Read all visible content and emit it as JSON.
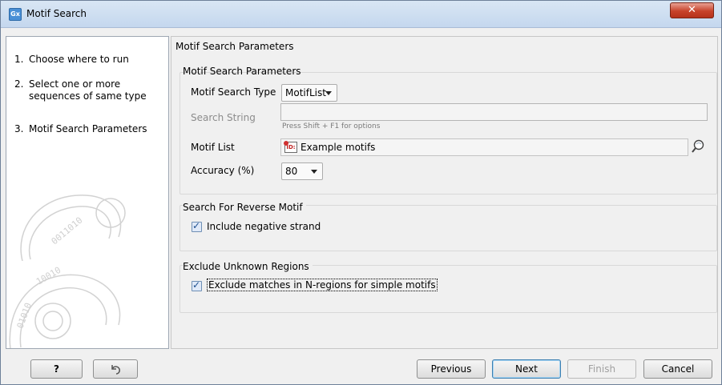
{
  "window": {
    "title": "Motif Search",
    "app_icon_text": "Gx",
    "close_glyph": "✕"
  },
  "steps": [
    {
      "num": "1.",
      "label": "Choose where to run"
    },
    {
      "num": "2.",
      "label": "Select one or more sequences of same type"
    },
    {
      "num": "3.",
      "label": "Motif Search Parameters"
    }
  ],
  "content": {
    "header": "Motif Search Parameters",
    "params_group": {
      "title": "Motif Search Parameters",
      "type_label": "Motif Search Type",
      "type_value": "MotifList",
      "search_string_label": "Search String",
      "search_string_value": "",
      "search_string_hint": "Press Shift + F1 for options",
      "motif_list_label": "Motif List",
      "motif_list_value": "Example motifs",
      "motif_list_icon_text": "ID:",
      "accuracy_label": "Accuracy (%)",
      "accuracy_value": "80"
    },
    "reverse_group": {
      "title": "Search For Reverse Motif",
      "checkbox_label": "Include negative strand",
      "checked": true
    },
    "unknown_group": {
      "title": "Exclude Unknown Regions",
      "checkbox_label": "Exclude matches in N-regions for simple motifs",
      "checked": true
    }
  },
  "footer": {
    "help_label": "?",
    "reset_icon": "undo-icon",
    "previous_label": "Previous",
    "next_label": "Next",
    "finish_label": "Finish",
    "cancel_label": "Cancel"
  },
  "colors": {
    "titlebar": "#c4d7ee",
    "close_button": "#c7422a",
    "checkbox_fill": "#dfe9f8"
  }
}
